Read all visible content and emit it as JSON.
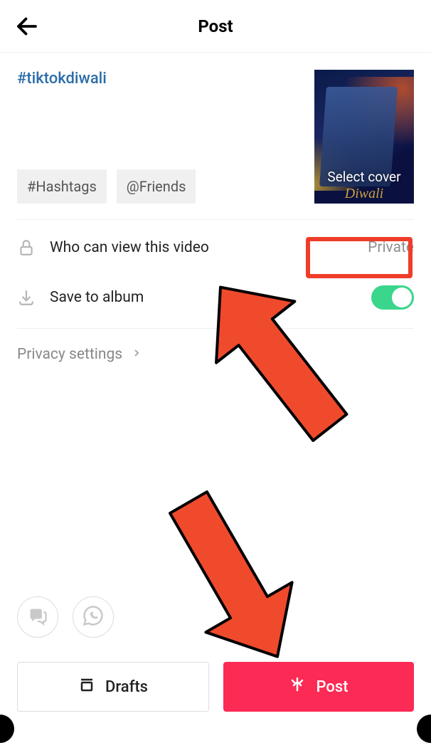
{
  "header": {
    "title": "Post"
  },
  "compose": {
    "caption": "#tiktokdiwali",
    "chip_hashtags": "#Hashtags",
    "chip_friends": "@Friends",
    "cover_label": "Select cover",
    "cover_sub": "Diwali"
  },
  "rows": {
    "privacy_label": "Who can view this video",
    "privacy_value": "Private",
    "save_label": "Save to album",
    "save_on": true,
    "settings_label": "Privacy settings"
  },
  "bottom": {
    "drafts": "Drafts",
    "post": "Post"
  }
}
